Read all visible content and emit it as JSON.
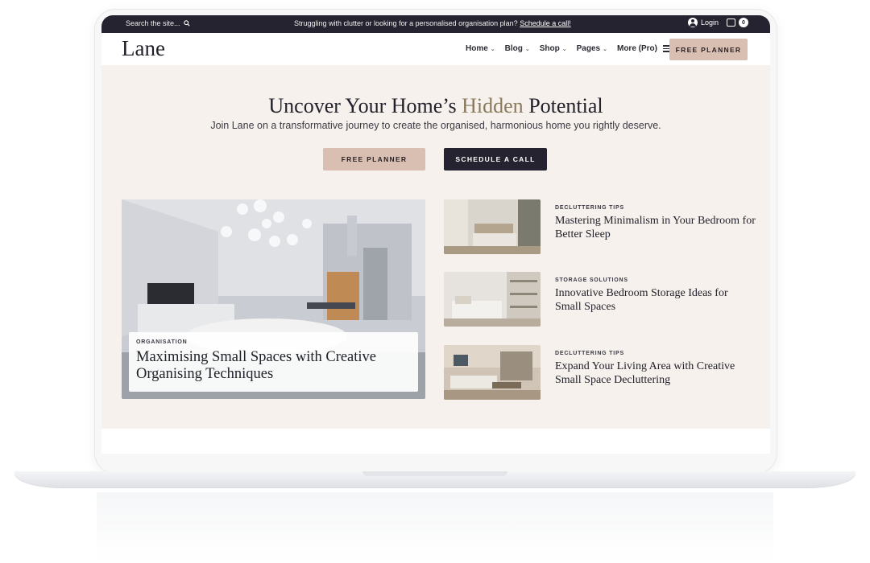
{
  "topbar": {
    "search_placeholder": "Search the site...",
    "promo_text": "Struggling with clutter or looking for a personalised organisation plan?",
    "promo_link": "Schedule a call!",
    "login_label": "Login",
    "cart_count": "0"
  },
  "nav": {
    "logo": "Lane",
    "menu": [
      {
        "label": "Home"
      },
      {
        "label": "Blog"
      },
      {
        "label": "Shop"
      },
      {
        "label": "Pages"
      },
      {
        "label": "More (Pro)"
      }
    ],
    "cta_label": "FREE PLANNER"
  },
  "hero": {
    "title_pre": "Uncover Your Home’s",
    "title_accent": "Hidden",
    "title_post": "Potential",
    "subtitle": "Join Lane on a transformative journey to create the organised, harmonious home you rightly deserve.",
    "btn_primary": "FREE PLANNER",
    "btn_secondary": "SCHEDULE A CALL"
  },
  "feature": {
    "category": "ORGANISATION",
    "title": "Maximising Small Spaces with Creative Organising Techniques"
  },
  "posts": [
    {
      "category": "DECLUTTERING TIPS",
      "title": "Mastering Minimalism in Your Bedroom for Better Sleep"
    },
    {
      "category": "STORAGE SOLUTIONS",
      "title": "Innovative Bedroom Storage Ideas for Small Spaces"
    },
    {
      "category": "DECLUTTERING TIPS",
      "title": "Expand Your Living Area with Creative Small Space Decluttering"
    }
  ],
  "colors": {
    "dark": "#24232f",
    "accent_beige": "#d8bfb2",
    "hero_bg": "#f6f1ec",
    "accent_text": "#8a7a5c"
  }
}
